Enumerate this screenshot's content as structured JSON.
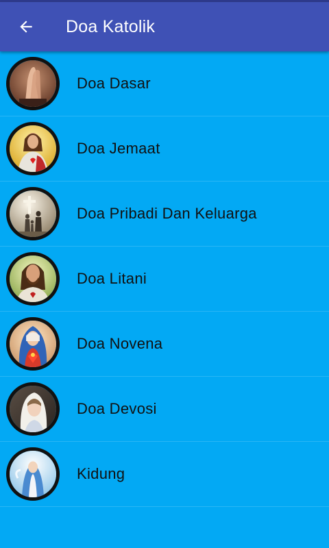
{
  "appbar": {
    "title": "Doa Katolik",
    "back_icon": "arrow-left-icon",
    "color": "#3f51b5"
  },
  "list": {
    "background": "#03a9f4",
    "items": [
      {
        "label": "Doa Dasar",
        "icon": "praying-hands-icon"
      },
      {
        "label": "Doa Jemaat",
        "icon": "sacred-heart-jesus-icon"
      },
      {
        "label": "Doa Pribadi Dan Keluarga",
        "icon": "family-cross-icon"
      },
      {
        "label": "Doa Litani",
        "icon": "jesus-portrait-icon"
      },
      {
        "label": "Doa Novena",
        "icon": "immaculate-heart-mary-icon"
      },
      {
        "label": "Doa Devosi",
        "icon": "praying-mary-icon"
      },
      {
        "label": "Kidung",
        "icon": "mary-in-sky-icon"
      }
    ]
  }
}
